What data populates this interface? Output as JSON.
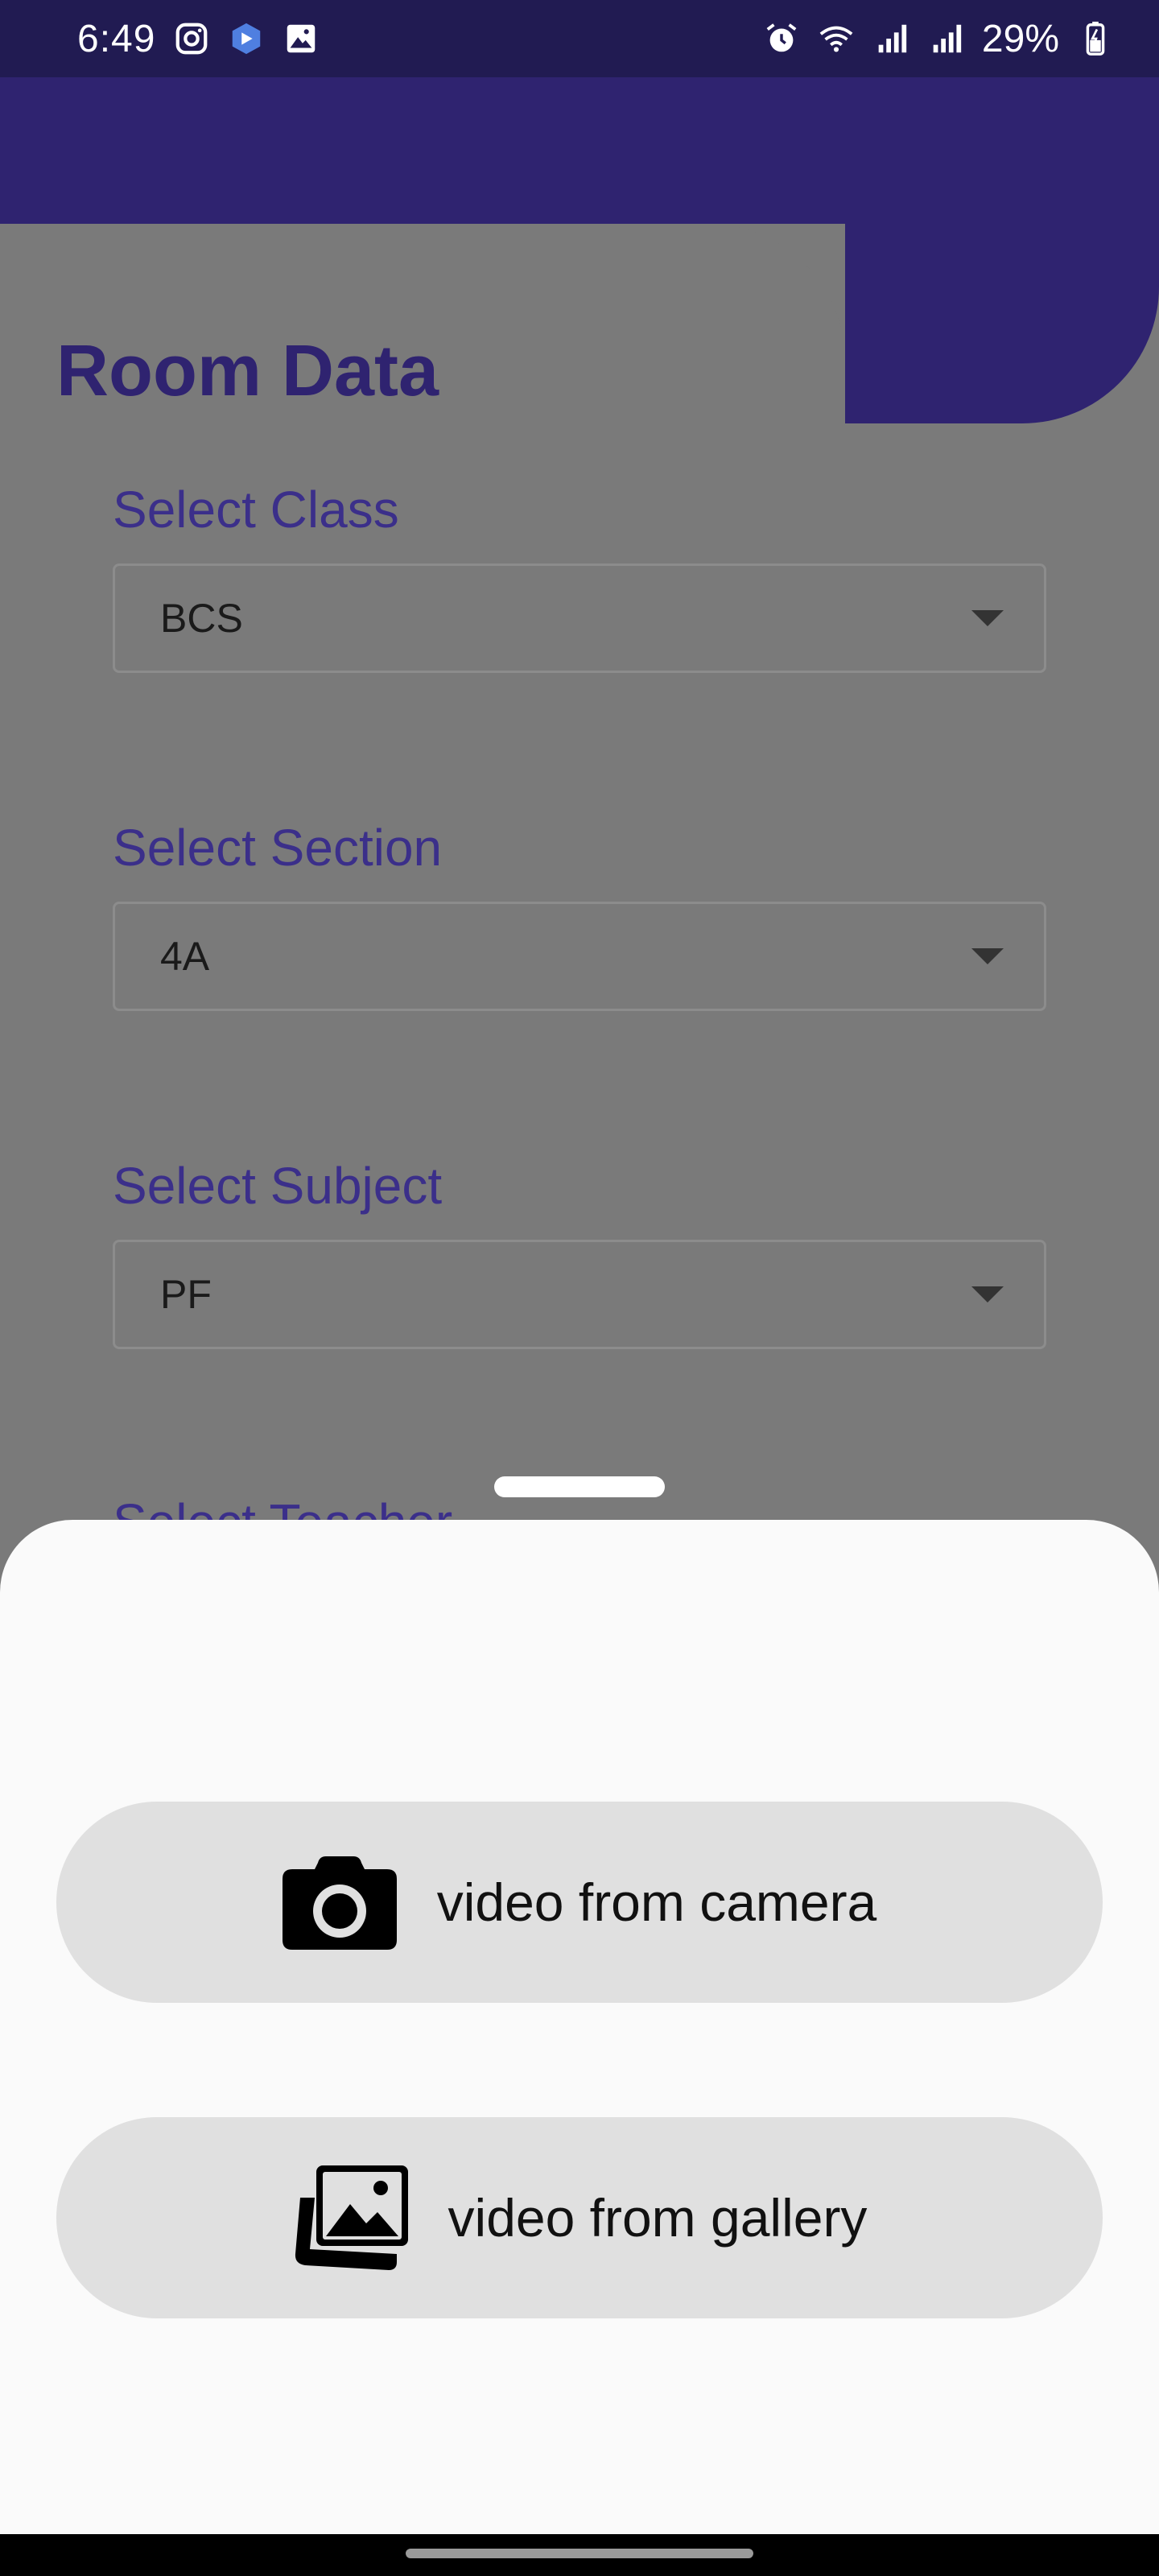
{
  "status_bar": {
    "time": "6:49",
    "battery": "29%",
    "left_icons": [
      "instagram-icon",
      "app-icon",
      "image-icon"
    ],
    "right_icons": [
      "alarm-icon",
      "wifi-icon",
      "signal-icon",
      "signal-icon",
      "battery-icon"
    ]
  },
  "page": {
    "title": "Room Data"
  },
  "form": {
    "class_label": "Select Class",
    "class_value": "BCS",
    "section_label": "Select Section",
    "section_value": "4A",
    "subject_label": "Select Subject",
    "subject_value": "PF",
    "teacher_label": "Select Teacher"
  },
  "sheet": {
    "camera_label": "video from camera",
    "gallery_label": "video from gallery"
  },
  "colors": {
    "primary": "#2f2370",
    "label": "#3b2f8a",
    "scrim": "#7a7a7a",
    "sheet": "#fafafa",
    "button": "#e0e0e0"
  }
}
